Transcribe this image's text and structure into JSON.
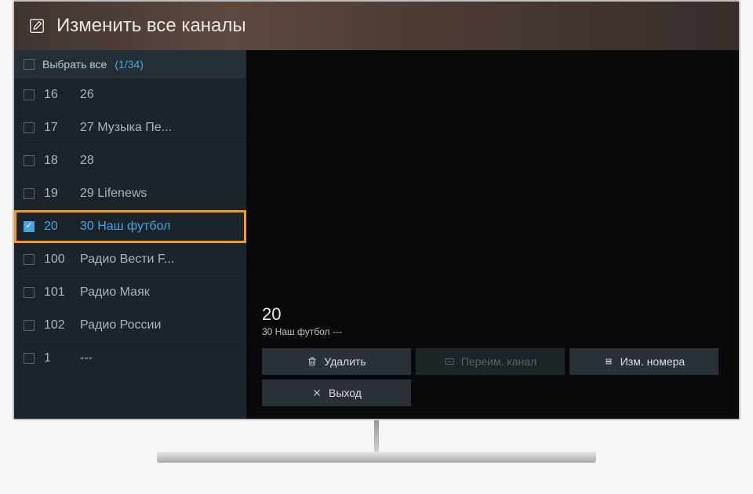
{
  "header": {
    "title": "Изменить все каналы"
  },
  "select_all": {
    "label": "Выбрать все",
    "count": "(1/34)"
  },
  "channels": [
    {
      "num": "16",
      "name": "26",
      "checked": false
    },
    {
      "num": "17",
      "name": "27 Музыка Пе...",
      "checked": false
    },
    {
      "num": "18",
      "name": "28",
      "checked": false
    },
    {
      "num": "19",
      "name": "29 Lifenews",
      "checked": false
    },
    {
      "num": "20",
      "name": "30 Наш футбол",
      "checked": true
    },
    {
      "num": "100",
      "name": "Радио Вести F...",
      "checked": false
    },
    {
      "num": "101",
      "name": "Радио Маяк",
      "checked": false
    },
    {
      "num": "102",
      "name": "Радио России",
      "checked": false
    },
    {
      "num": "1",
      "name": "---",
      "checked": false
    }
  ],
  "selected": {
    "num": "20",
    "name_line": "30 Наш футбол ---"
  },
  "actions": {
    "delete": "Удалить",
    "rename": "Переим. канал",
    "renum": "Изм. номера",
    "exit": "Выход"
  }
}
